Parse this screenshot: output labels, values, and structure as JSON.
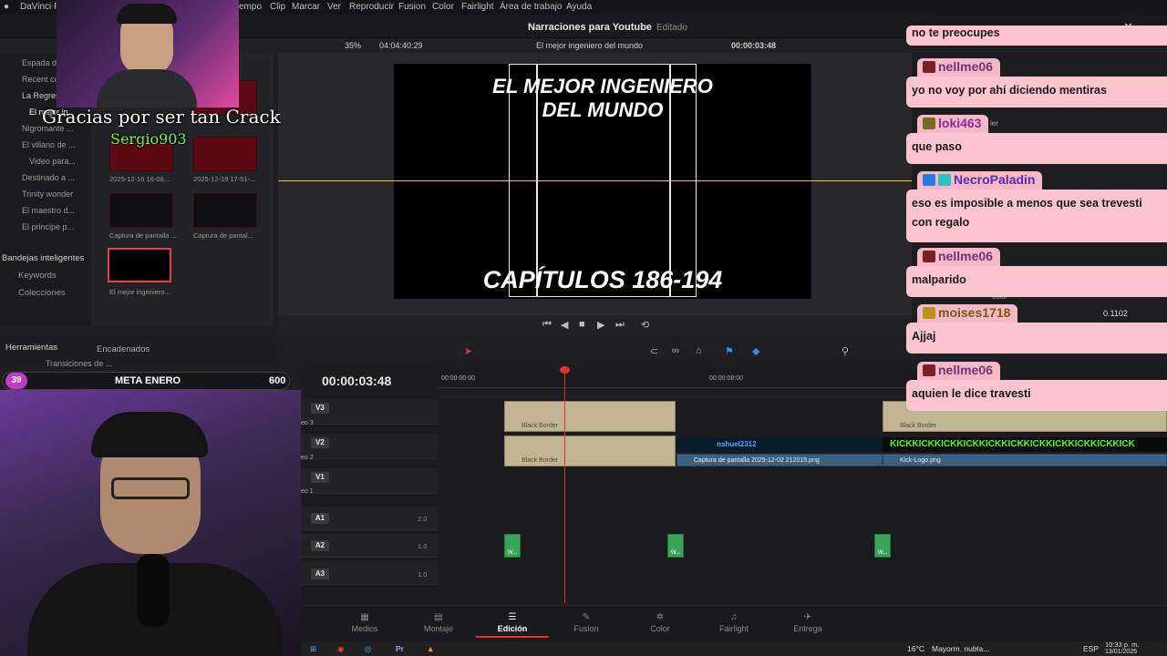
{
  "menu": {
    "app": "DaVinci R",
    "items": [
      "empo",
      "Clip",
      "Marcar",
      "Ver",
      "Reproducir",
      "Fusion",
      "Color",
      "Fairlight",
      "Área de trabajo",
      "Ayuda"
    ]
  },
  "project": {
    "title": "Narraciones para Youtube",
    "status": "Editado"
  },
  "viewer_bar": {
    "zoom": "35%",
    "duration": "04:04:40:29",
    "clip_name": "El mejor ingeniero del mundo",
    "timecode": "00:00:03:48"
  },
  "left_tree": [
    "Espada d",
    "Recent co",
    "La Regres",
    "El mejor in",
    "Nigromante ...",
    "El villano de ...",
    "Video para...",
    "Destinado a ...",
    "Trinity wonder",
    "El maestro d...",
    "El principe p..."
  ],
  "media_pool": [
    {
      "label": "2025-12-16 16-06..."
    },
    {
      "label": "2025-12-19 17-51-..."
    },
    {
      "label": "Captura de pantalla ..."
    },
    {
      "label": "Captura de pantal..."
    },
    {
      "label": "El mejor ingeniero..."
    }
  ],
  "smart_bins": {
    "title": "Bandejas inteligentes",
    "items": [
      "Keywords",
      "Colecciones"
    ]
  },
  "preview": {
    "title": "EL MEJOR INGENIERO DEL MUNDO",
    "subtitle": "CAPÍTULOS 186-194"
  },
  "tools": {
    "header": "Herramientas",
    "items": [
      "Transiciones de ...",
      "Transiciones de ..."
    ],
    "tab": "Encadenados"
  },
  "timeline": {
    "timecode": "00:00:03:48",
    "ruler": [
      "00:00:00:00",
      "00:00:08:00"
    ],
    "tracks": [
      {
        "id": "V3",
        "name": "eo 3"
      },
      {
        "id": "V2",
        "name": "eo 2"
      },
      {
        "id": "V1",
        "name": "eo 1"
      },
      {
        "id": "A1",
        "vol": "2.0"
      },
      {
        "id": "A2",
        "vol": "1.0"
      },
      {
        "id": "A3",
        "vol": "1.0"
      }
    ],
    "clips": {
      "black_border": "Black Border",
      "capture": "Captura de pantalla 2025-12-02 212015.png",
      "kick_logo": "Kick-Logo.png",
      "nahuel": "nahuel2312",
      "kick_text": "KICKKICKKICKKICKKICKKICKKICKKICKKICKKICKKICK",
      "audio": "W..."
    }
  },
  "pages": [
    {
      "label": "Medios"
    },
    {
      "label": "Montaje"
    },
    {
      "label": "Edición"
    },
    {
      "label": "Fusion"
    },
    {
      "label": "Color"
    },
    {
      "label": "Fairlight"
    },
    {
      "label": "Entrega"
    }
  ],
  "taskbar": {
    "weather": "16°C",
    "weather_text": "Mayorm. nubla...",
    "lang": "ESP",
    "time": "10:33 p. m.",
    "date": "13/01/2026"
  },
  "stream": {
    "thanks": "Gracias por ser tan Crack",
    "donor": "Sergio903",
    "goal_count": "39",
    "goal_label": "META ENERO",
    "goal_target": "600"
  },
  "chat": [
    {
      "user": "",
      "msg": "no te preocupes"
    },
    {
      "user": "nellme06",
      "msg": "yo no voy por ahí diciendo mentiras"
    },
    {
      "user": "loki463",
      "msg": "que paso"
    },
    {
      "user": "NecroPaladin",
      "msg": "eso es imposible a menos que sea trevesti con regalo"
    },
    {
      "user": "nellme06",
      "msg": "malparido"
    },
    {
      "user": "moises1718",
      "msg": "Ajjaj"
    },
    {
      "user": "nellme06",
      "msg": "aquien le dice travesti"
    }
  ],
  "inspector": {
    "value": "0.1102",
    "label": "ier",
    "color_label": "Color"
  },
  "colors": {
    "accent": "#e03030",
    "chat_bg": "#fcc4cf",
    "clip_tan": "#c2b592",
    "audio_green": "#3aa55a",
    "kick_green": "#53fc18"
  }
}
